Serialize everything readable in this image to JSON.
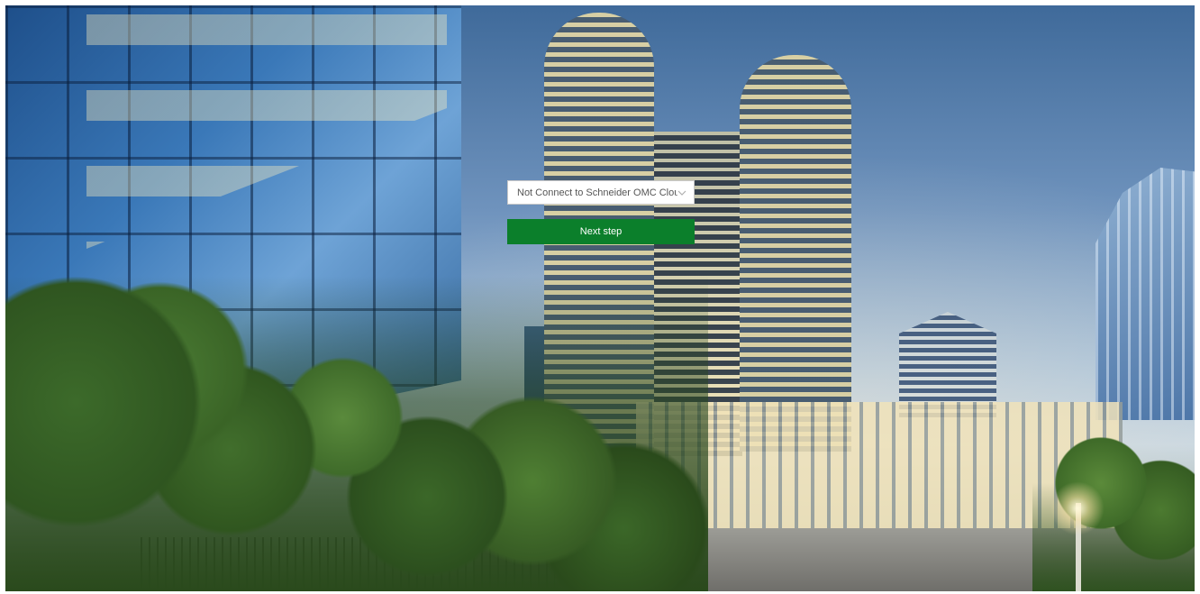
{
  "cloud_form": {
    "connection_select": {
      "selected_value": "Not Connect to Schneider OMC Cloud",
      "icon": "chevron-down-icon"
    },
    "next_button_label": "Next step"
  },
  "colors": {
    "primary_button": "#0b7f2b",
    "select_background": "#ffffff",
    "select_text": "#555555"
  },
  "background": {
    "icon": "city-skyline-photo"
  }
}
